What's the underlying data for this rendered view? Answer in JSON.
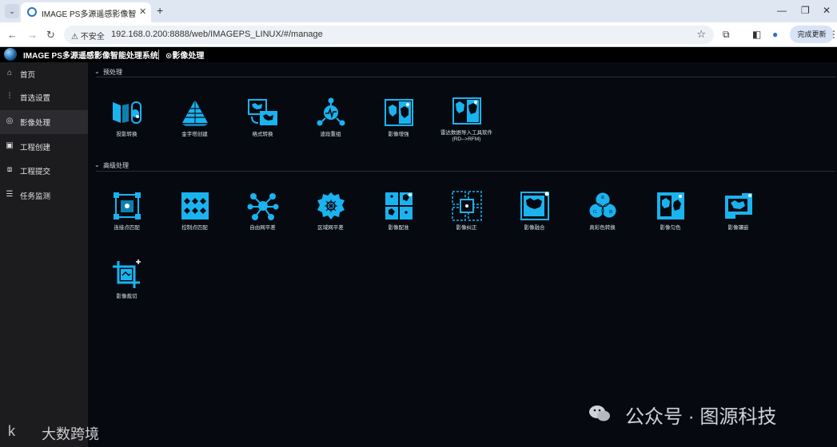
{
  "browser": {
    "tab_title": "IMAGE PS多源遥感影像智能处理",
    "tab_close": "✕",
    "new_tab": "+",
    "insecure_label": "不安全",
    "url": "192.168.0.200:8888/web/IMAGEPS_LINUX/#/manage",
    "update_button": "完成更新"
  },
  "app": {
    "title": "IMAGE PS多源遥感影像智能处理系统",
    "current_page": "影像处理"
  },
  "sidebar": {
    "items": [
      {
        "label": "首页",
        "icon": "home-icon"
      },
      {
        "label": "首选设置",
        "icon": "sliders-icon"
      },
      {
        "label": "影像处理",
        "icon": "image-process-icon",
        "active": true
      },
      {
        "label": "工程创建",
        "icon": "project-create-icon"
      },
      {
        "label": "工程提交",
        "icon": "project-submit-icon"
      },
      {
        "label": "任务监测",
        "icon": "task-monitor-icon"
      }
    ]
  },
  "sections": {
    "preprocess": {
      "title": "预处理",
      "tools": [
        "投影转换",
        "金字塔创建",
        "格式转换",
        "波段重组",
        "影像增强",
        "雷达数据导入工具软件",
        "(RD-->RFM)"
      ]
    },
    "advanced": {
      "title": "高级处理",
      "tools": [
        "连接点匹配",
        "控制点匹配",
        "自由网平差",
        "区域网平差",
        "影像配准",
        "影像纠正",
        "影像融合",
        "真彩色转换",
        "影像匀色",
        "影像镶嵌",
        "影像裁切"
      ]
    }
  },
  "watermarks": {
    "wechat": "公众号 · 图源科技",
    "brand": "大数跨境",
    "brand_logo": "k"
  },
  "colors": {
    "accent": "#1ab3f0",
    "background": "#05080c",
    "sidebar": "#1c1c1f"
  }
}
